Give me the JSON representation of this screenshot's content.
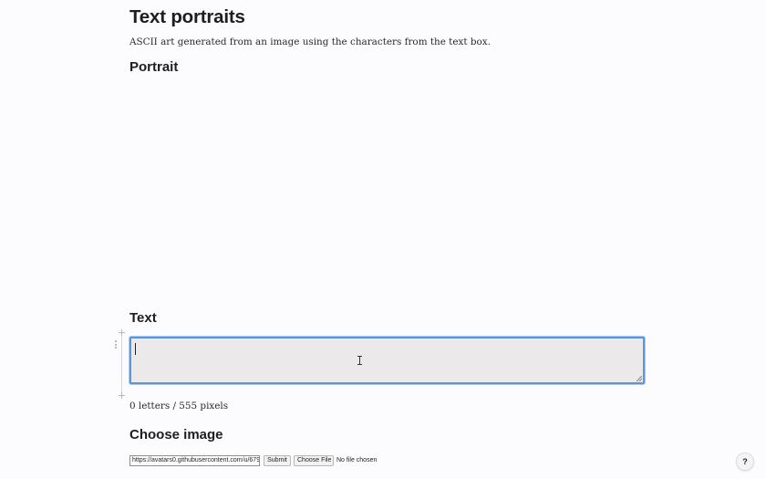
{
  "page": {
    "title": "Text portraits",
    "description": "ASCII art generated from an image using the characters from the text box."
  },
  "portrait": {
    "heading": "Portrait"
  },
  "text_section": {
    "heading": "Text",
    "textarea_value": "",
    "counter": "0 letters / 555 pixels"
  },
  "choose_image": {
    "heading": "Choose image",
    "url_value": "https://avatars0.githubusercontent.com/u/679",
    "submit_label": "Submit",
    "choose_file_label": "Choose File",
    "file_status": "No file chosen"
  },
  "help": {
    "label": "?"
  },
  "colors": {
    "focus_border": "#5b95e0",
    "textarea_bg": "#ece9ea",
    "page_bg": "#fcfbfd"
  },
  "icons": {
    "cell_add_top": "plus-icon",
    "cell_add_bottom": "plus-icon",
    "cell_menu": "vertical-dots-icon",
    "text_cursor": "ibeam-cursor-icon"
  }
}
